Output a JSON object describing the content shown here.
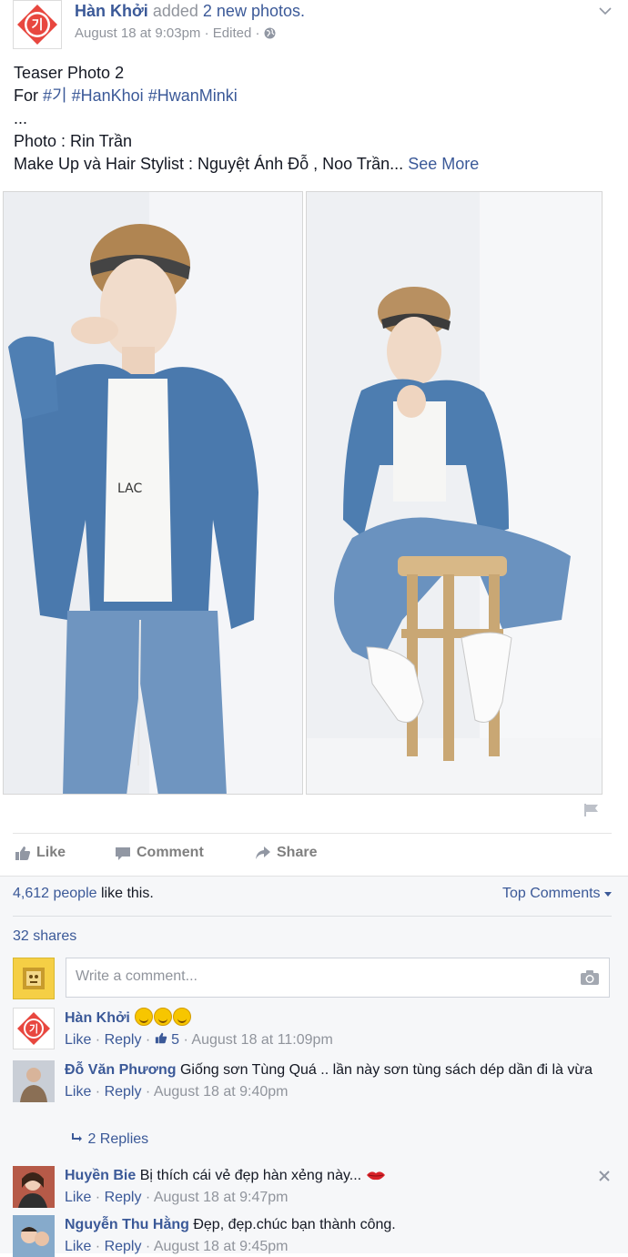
{
  "post": {
    "author": "Hàn Khởi",
    "action": "added",
    "photo_count": "2 new photos.",
    "timestamp": "August 18 at 9:03pm",
    "edited": "· Edited ·",
    "text_line1": "Teaser Photo 2",
    "text_for": "For",
    "hashtag1": "#기",
    "hashtag2": "#HanKhoi",
    "hashtag3": "#HwanMinki",
    "text_ellipsis": "...",
    "text_photo": "Photo : Rin Trần",
    "text_makeup": "Make Up và Hair Stylist : Nguyệt Ánh Đỗ , Noo Trần...",
    "see_more": "See More",
    "avatar_glyph": "기"
  },
  "actions": {
    "like": "Like",
    "comment": "Comment",
    "share": "Share"
  },
  "ufi": {
    "likes_count": "4,612 people",
    "likes_suffix": "like this.",
    "top_comments": "Top Comments",
    "shares": "32 shares",
    "comment_placeholder": "Write a comment..."
  },
  "comments": [
    {
      "author": "Hàn Khởi",
      "text": "",
      "like": "Like",
      "reply": "Reply",
      "likes": "5",
      "time": "August 18 at 11:09pm",
      "avatar_glyph": "기"
    },
    {
      "author": "Đỗ Văn Phương",
      "text": "Giống sơn Tùng Quá .. lần này sơn tùng sách dép dần đi là vừa",
      "like": "Like",
      "reply": "Reply",
      "time": "August 18 at 9:40pm"
    },
    {
      "author": "Huyền Bie",
      "text": "Bị thích cái vẻ đẹp hàn xẻng này...",
      "like": "Like",
      "reply": "Reply",
      "time": "August 18 at 9:47pm"
    },
    {
      "author": "Nguyễn Thu Hằng",
      "text": "Đẹp, đẹp.chúc bạn thành công.",
      "like": "Like",
      "reply": "Reply",
      "time": "August 18 at 9:45pm"
    }
  ],
  "replies_label": "2 Replies",
  "icons": {
    "chevron": "chevron-down-icon",
    "globe": "globe-icon",
    "flag": "flag-icon",
    "like": "thumbs-up-icon",
    "comment": "speech-bubble-icon",
    "share": "share-arrow-icon",
    "camera": "camera-icon",
    "close": "close-icon",
    "reply": "reply-arrow-icon"
  },
  "colors": {
    "link": "#3b5998",
    "meta": "#90949c",
    "ufi_bg": "#f6f7f9",
    "logo_red": "#e8473f"
  }
}
